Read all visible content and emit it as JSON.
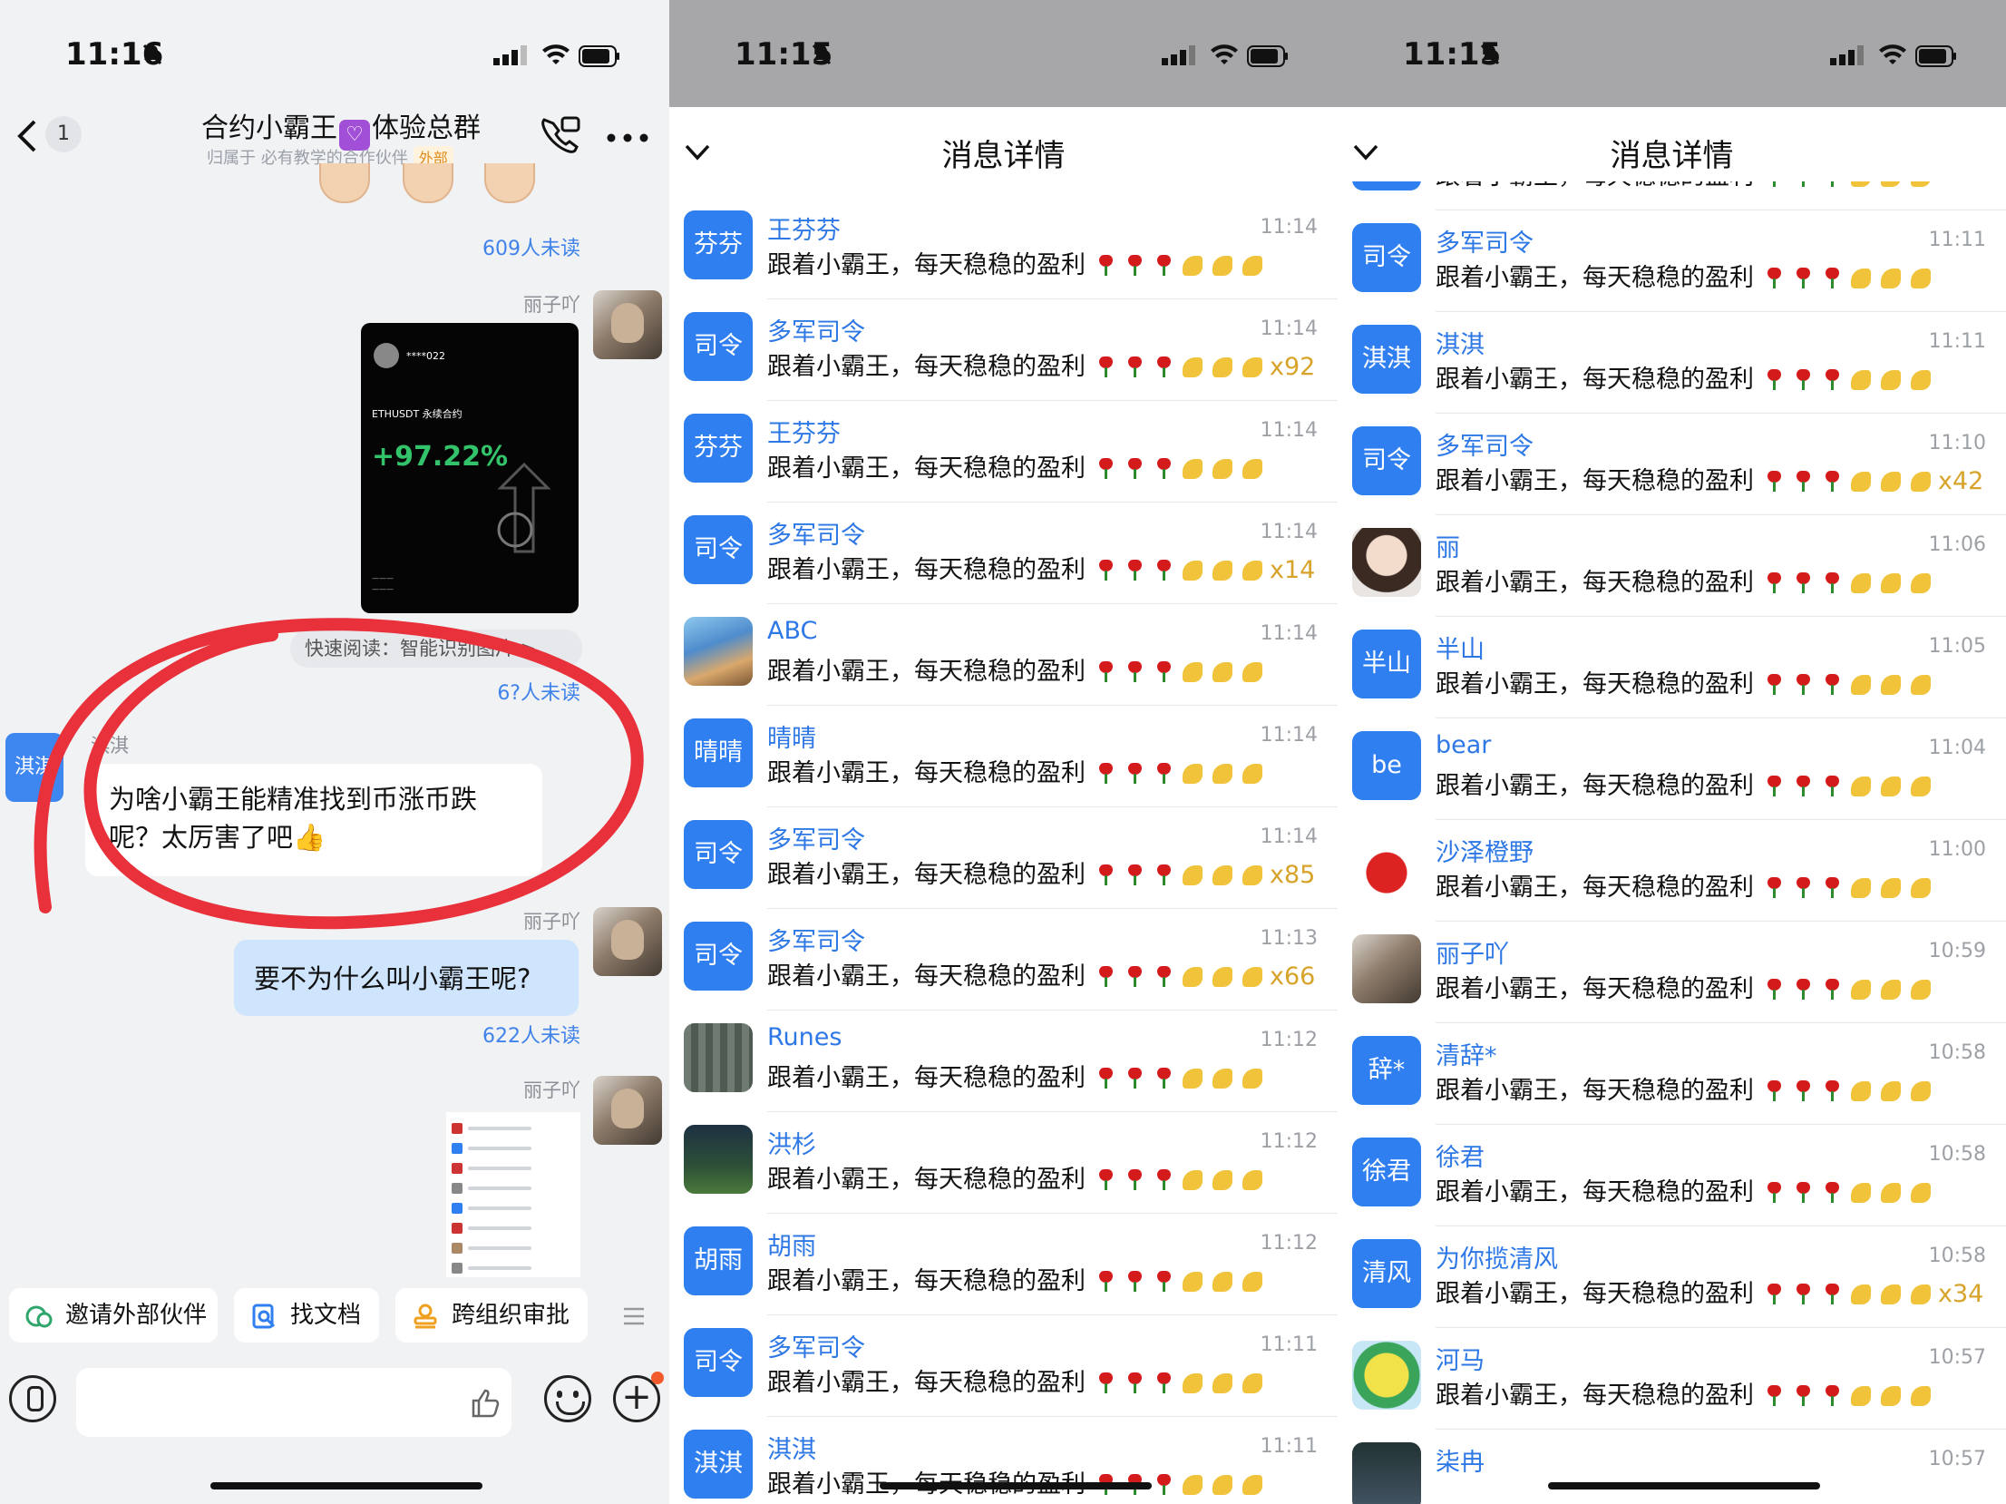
{
  "colors": {
    "accent_blue": "#2f7ff0",
    "link_blue": "#2e78e6",
    "count_gold": "#d8a32a",
    "annotation_red": "#e8313a",
    "sheet_dim": "#a7a7a9",
    "bubble_self": "#cfe4fd"
  },
  "left_panel": {
    "status": {
      "time": "11:16",
      "icons": [
        "bell-slash-icon",
        "cellular-signal-icon",
        "wifi-icon",
        "battery-icon"
      ]
    },
    "nav": {
      "back_count": "1",
      "title_before": "合约小霸王",
      "title_heart": "♡",
      "title_after": "体验总群",
      "subtitle": "归属于 必有教学的合作伙伴",
      "external_tag": "外部"
    },
    "messages": {
      "unread_1": "609人未读",
      "sender_1": "丽子吖",
      "image_card": {
        "uid": "****022",
        "pair": "ETHUSDT 永续合约",
        "pnl": "+97.22%"
      },
      "quick_read": "快速阅读：智能识别图片 >",
      "unread_2": "6?人未读",
      "side_tag": "淇淇",
      "sender_2": "淇淇",
      "bubble_left": "为啥小霸王能精准找到币涨币跌呢？太厉害了吧👍",
      "sender_3": "丽子吖",
      "bubble_right": "要不为什么叫小霸王呢?",
      "unread_3": "622人未读",
      "sender_4": "丽子吖"
    },
    "quick_actions": [
      "邀请外部伙伴",
      "找文档",
      "跨组织审批"
    ]
  },
  "sheet_title": "消息详情",
  "middle_panel": {
    "status": {
      "time": "11:15"
    },
    "rows": [
      {
        "avatar": "芬芬",
        "name": "王芬芬",
        "time": "11:14",
        "text": "跟着小霸王，每天稳稳的盈利",
        "count": ""
      },
      {
        "avatar": "司令",
        "name": "多军司令",
        "time": "11:14",
        "text": "跟着小霸王，每天稳稳的盈利",
        "count": "x92"
      },
      {
        "avatar": "芬芬",
        "name": "王芬芬",
        "time": "11:14",
        "text": "跟着小霸王，每天稳稳的盈利",
        "count": ""
      },
      {
        "avatar": "司令",
        "name": "多军司令",
        "time": "11:14",
        "text": "跟着小霸王，每天稳稳的盈利",
        "count": "x14"
      },
      {
        "avatar": "",
        "avatar_img": "img-rabbit",
        "name": "ABC",
        "time": "11:14",
        "text": "跟着小霸王，每天稳稳的盈利",
        "count": ""
      },
      {
        "avatar": "晴晴",
        "name": "晴晴",
        "time": "11:14",
        "text": "跟着小霸王，每天稳稳的盈利",
        "count": ""
      },
      {
        "avatar": "司令",
        "name": "多军司令",
        "time": "11:14",
        "text": "跟着小霸王，每天稳稳的盈利",
        "count": "x85"
      },
      {
        "avatar": "司令",
        "name": "多军司令",
        "time": "11:13",
        "text": "跟着小霸王，每天稳稳的盈利",
        "count": "x66"
      },
      {
        "avatar": "",
        "avatar_img": "img-runes",
        "name": "Runes",
        "time": "11:12",
        "text": "跟着小霸王，每天稳稳的盈利",
        "count": ""
      },
      {
        "avatar": "",
        "avatar_img": "img-city",
        "name": "洪杉",
        "time": "11:12",
        "text": "跟着小霸王，每天稳稳的盈利",
        "count": ""
      },
      {
        "avatar": "胡雨",
        "name": "胡雨",
        "time": "11:12",
        "text": "跟着小霸王，每天稳稳的盈利",
        "count": ""
      },
      {
        "avatar": "司令",
        "name": "多军司令",
        "time": "11:11",
        "text": "跟着小霸王，每天稳稳的盈利",
        "count": ""
      },
      {
        "avatar": "淇淇",
        "name": "淇淇",
        "time": "11:11",
        "text": "跟着小霸王，每天稳稳的盈利",
        "count": ""
      }
    ]
  },
  "right_panel": {
    "status": {
      "time": "11:15"
    },
    "rows": [
      {
        "avatar": "",
        "name": "",
        "time": "",
        "text": "跟着小霸王，每天稳稳的盈利",
        "count": ""
      },
      {
        "avatar": "司令",
        "name": "多军司令",
        "time": "11:11",
        "text": "跟着小霸王，每天稳稳的盈利",
        "count": ""
      },
      {
        "avatar": "淇淇",
        "name": "淇淇",
        "time": "11:11",
        "text": "跟着小霸王，每天稳稳的盈利",
        "count": ""
      },
      {
        "avatar": "司令",
        "name": "多军司令",
        "time": "11:10",
        "text": "跟着小霸王，每天稳稳的盈利",
        "count": "x42"
      },
      {
        "avatar": "",
        "avatar_img": "img-girl",
        "name": "丽",
        "time": "11:06",
        "text": "跟着小霸王，每天稳稳的盈利",
        "count": ""
      },
      {
        "avatar": "半山",
        "name": "半山",
        "time": "11:05",
        "text": "跟着小霸王，每天稳稳的盈利",
        "count": ""
      },
      {
        "avatar": "be",
        "name": "bear",
        "time": "11:04",
        "text": "跟着小霸王，每天稳稳的盈利",
        "count": ""
      },
      {
        "avatar": "",
        "avatar_img": "img-bug",
        "name": "沙泽橙野",
        "time": "11:00",
        "text": "跟着小霸王，每天稳稳的盈利",
        "count": ""
      },
      {
        "avatar": "",
        "avatar_img": "img-photo",
        "name": "丽子吖",
        "time": "10:59",
        "text": "跟着小霸王，每天稳稳的盈利",
        "count": ""
      },
      {
        "avatar": "辞*",
        "name": "清辞*",
        "time": "10:58",
        "text": "跟着小霸王，每天稳稳的盈利",
        "count": ""
      },
      {
        "avatar": "徐君",
        "name": "徐君",
        "time": "10:58",
        "text": "跟着小霸王，每天稳稳的盈利",
        "count": ""
      },
      {
        "avatar": "清风",
        "name": "为你揽清风",
        "time": "10:58",
        "text": "跟着小霸王，每天稳稳的盈利",
        "count": "x34"
      },
      {
        "avatar": "",
        "avatar_img": "img-hema",
        "name": "河马",
        "time": "10:57",
        "text": "跟着小霸王，每天稳稳的盈利",
        "count": ""
      },
      {
        "avatar": "",
        "avatar_img": "img-dark",
        "name": "柒冉",
        "time": "10:57",
        "text": "",
        "count": ""
      }
    ]
  }
}
